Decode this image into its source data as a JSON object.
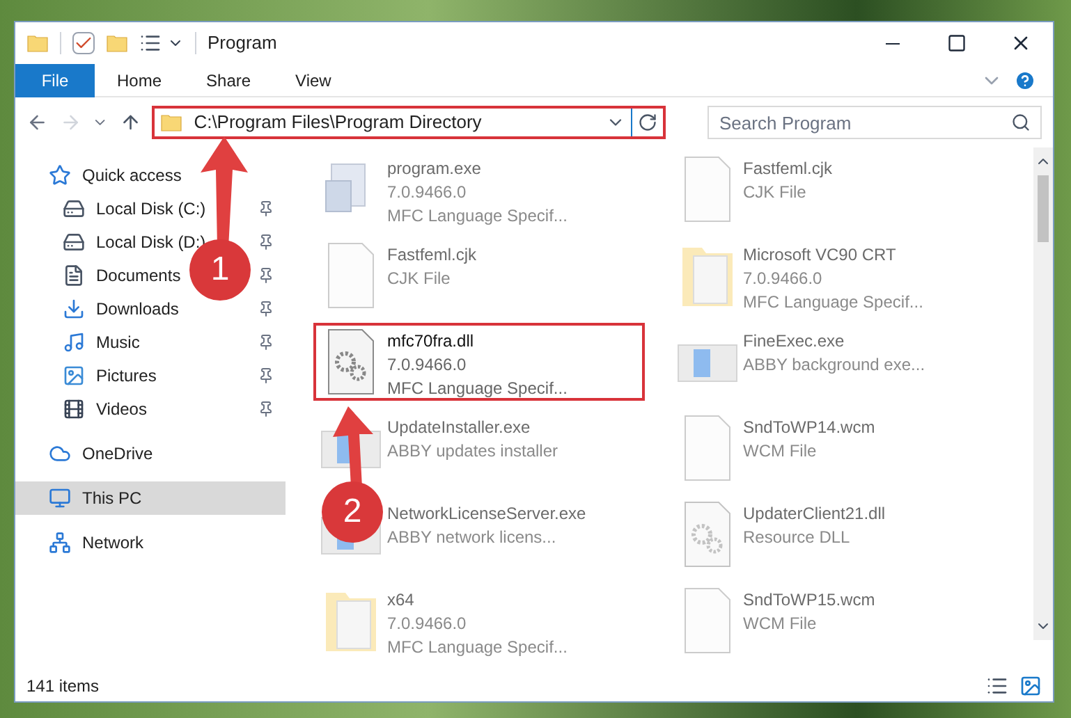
{
  "window": {
    "title": "Program"
  },
  "ribbon_tabs": [
    {
      "label": "File",
      "selected": true
    },
    {
      "label": "Home",
      "selected": false
    },
    {
      "label": "Share",
      "selected": false
    },
    {
      "label": "View",
      "selected": false
    }
  ],
  "address_bar": {
    "path": "C:\\Program Files\\Program Directory"
  },
  "search": {
    "placeholder": "Search Program"
  },
  "sidebar": {
    "items": [
      {
        "label": "Quick access",
        "selected": false,
        "children": [
          {
            "label": "Local Disk (C:)",
            "pinned": true
          },
          {
            "label": "Local Disk (D:)",
            "pinned": true
          },
          {
            "label": "Documents",
            "pinned": true
          },
          {
            "label": "Downloads",
            "pinned": true
          },
          {
            "label": "Music",
            "pinned": true
          },
          {
            "label": "Pictures",
            "pinned": true
          },
          {
            "label": "Videos",
            "pinned": true
          }
        ]
      },
      {
        "label": "OneDrive",
        "selected": false
      },
      {
        "label": "This PC",
        "selected": true
      },
      {
        "label": "Network",
        "selected": false
      }
    ]
  },
  "files": [
    {
      "kind": "app",
      "name": "program.exe",
      "lines": [
        "7.0.9466.0",
        "MFC Language Specif..."
      ],
      "blurred": true,
      "highlighted": false
    },
    {
      "kind": "document",
      "name": "Fastfeml.cjk",
      "lines": [
        "CJK File"
      ],
      "blurred": true,
      "highlighted": false
    },
    {
      "kind": "document",
      "name": "Fastfeml.cjk",
      "lines": [
        "CJK File"
      ],
      "blurred": true,
      "highlighted": false
    },
    {
      "kind": "folder",
      "name": "Microsoft VC90 CRT",
      "lines": [
        "7.0.9466.0",
        "MFC Language Specif..."
      ],
      "blurred": true,
      "highlighted": false
    },
    {
      "kind": "settings",
      "name": "mfc70fra.dll",
      "lines": [
        "7.0.9466.0",
        "MFC Language Specif..."
      ],
      "blurred": false,
      "highlighted": true
    },
    {
      "kind": "window",
      "name": "FineExec.exe",
      "lines": [
        "ABBY background exe..."
      ],
      "blurred": true,
      "highlighted": false
    },
    {
      "kind": "window",
      "name": "UpdateInstaller.exe",
      "lines": [
        "ABBY updates installer"
      ],
      "blurred": true,
      "highlighted": false
    },
    {
      "kind": "document",
      "name": "SndToWP14.wcm",
      "lines": [
        "WCM File"
      ],
      "blurred": true,
      "highlighted": false
    },
    {
      "kind": "window",
      "name": "NetworkLicenseServer.exe",
      "lines": [
        "ABBY network licens..."
      ],
      "blurred": true,
      "highlighted": false
    },
    {
      "kind": "settings",
      "name": "UpdaterClient21.dll",
      "lines": [
        "Resource DLL"
      ],
      "blurred": true,
      "highlighted": false
    },
    {
      "kind": "folder",
      "name": "x64",
      "lines": [
        "7.0.9466.0",
        "MFC Language Specif..."
      ],
      "blurred": true,
      "highlighted": false
    },
    {
      "kind": "document",
      "name": "SndToWP15.wcm",
      "lines": [
        "WCM File"
      ],
      "blurred": true,
      "highlighted": false
    }
  ],
  "status_bar": {
    "item_count": "141 items"
  },
  "annotations": [
    {
      "label": "1"
    },
    {
      "label": "2"
    }
  ]
}
